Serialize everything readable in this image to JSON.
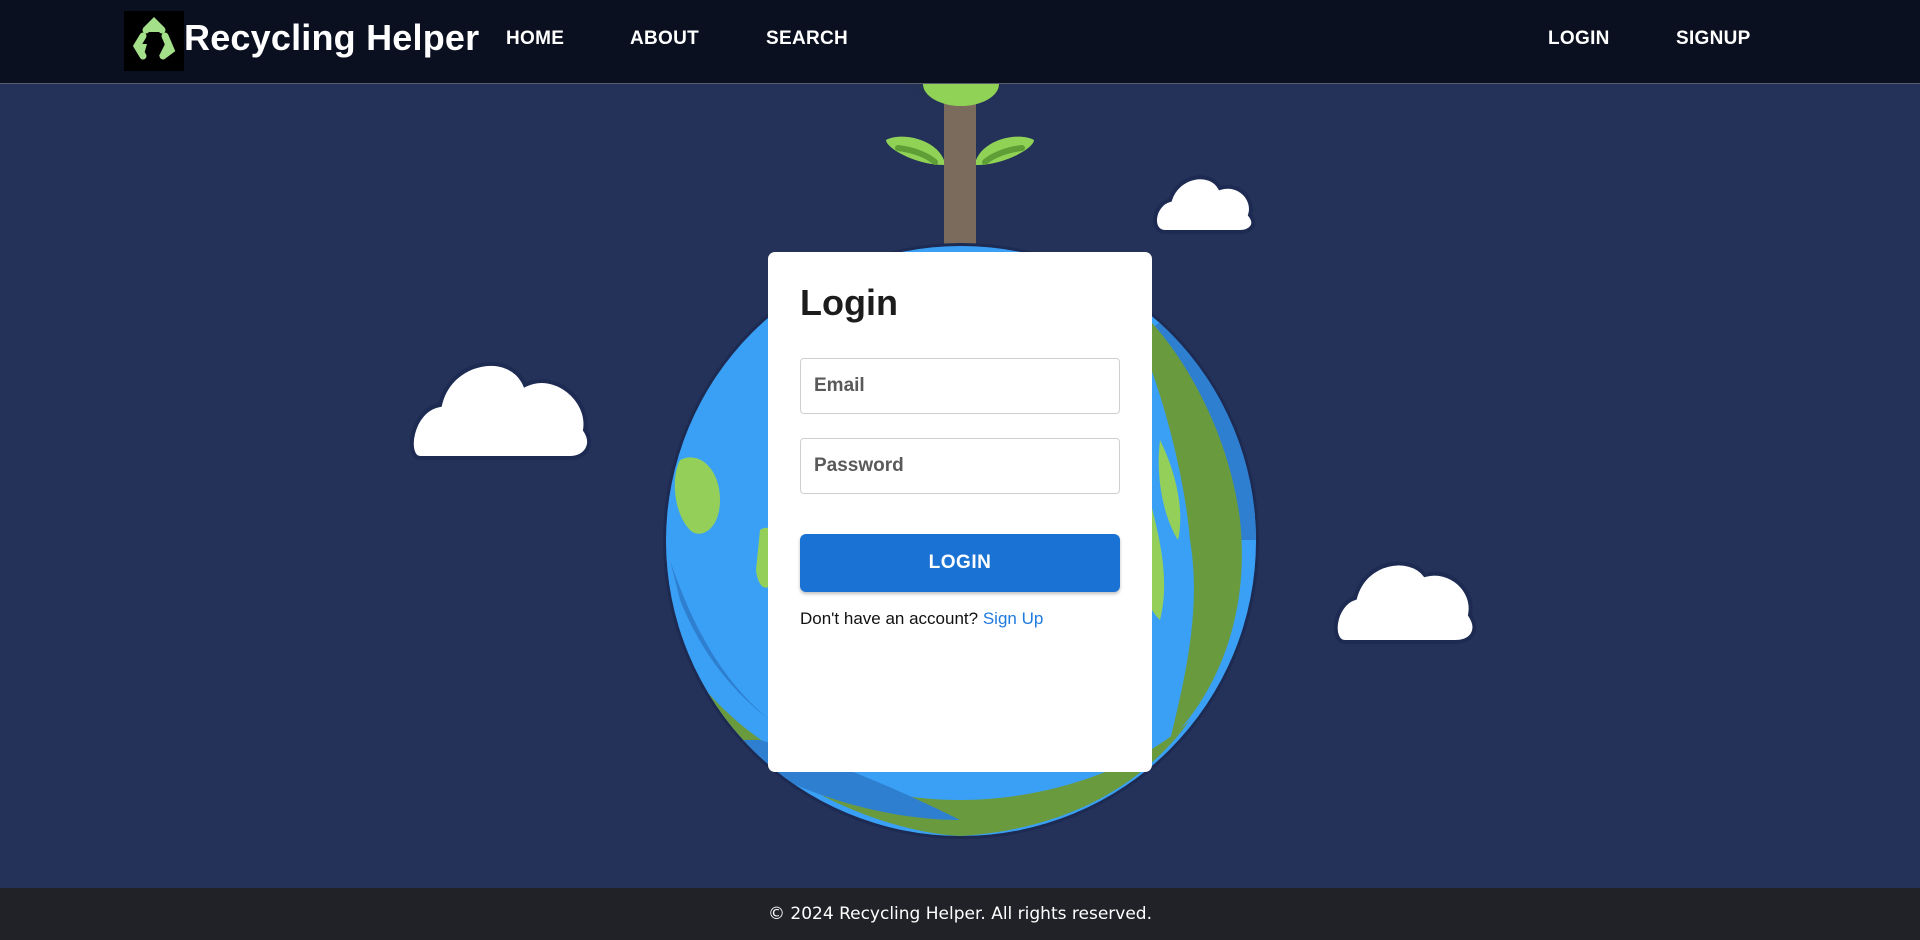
{
  "brand": {
    "title": "Recycling Helper",
    "logo_icon": "recycle-icon",
    "logo_color": "#a4e08a"
  },
  "nav": {
    "home": "HOME",
    "about": "ABOUT",
    "search": "SEARCH",
    "login": "LOGIN",
    "signup": "SIGNUP"
  },
  "login_form": {
    "title": "Login",
    "email_placeholder": "Email",
    "password_placeholder": "Password",
    "submit_label": "LOGIN",
    "signup_prompt": "Don't have an account?",
    "signup_link": "Sign Up"
  },
  "footer": {
    "copyright": "© 2024 Recycling Helper. All rights reserved."
  },
  "colors": {
    "background": "#243159",
    "navbar": "#0b1020",
    "primary_button": "#1a73d4",
    "link": "#1f7ae0",
    "footer": "#202227"
  }
}
